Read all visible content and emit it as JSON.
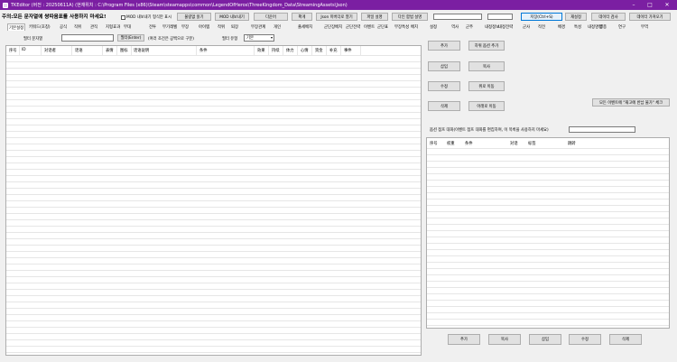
{
  "window": {
    "title": "TKEditor (버전 : 20250611A)  (현재위치 : C:\\Program Files (x86)\\Steam\\steamapps\\common\\LegendOfHeros\\ThreeKingdom_Data\\StreamingAssets\\Json)",
    "minimize": "–",
    "maximize": "□",
    "close": "✕"
  },
  "toolbar": {
    "notice": "주의:모든 문자열에 쌍따옴표를 사용하지 마세요!",
    "mod_checkbox_label": "MOD 내보내기 형식만 표시",
    "buttons": {
      "load_file": "불량없 읽기",
      "mod_export": "MOD 내보내기",
      "read": "다운어",
      "apply": "확게",
      "json_folder": "Json 미버더로 열기",
      "file_settings": "파일 설명",
      "language_settings": "다인 합법 설명",
      "save": "저장(Ctrl+S)",
      "reread": "재설정",
      "data_check": "데이터 검사",
      "data_import": "데이터 가져오기"
    }
  },
  "tabs": [
    "기본설정",
    "키워드(호칭)",
    "공식",
    "직위",
    "관직",
    "지형효과",
    "무대",
    "전투",
    "무기레벨",
    "무장",
    "아이템",
    "작위",
    "퇴장",
    "무장관계",
    "개인",
    "출세배치",
    "군단장배치",
    "군단전략",
    "이벤트",
    "군단표",
    "무장특성",
    "배치",
    "설정",
    "역사",
    "군주",
    "내정정보",
    "내정전략",
    "군사",
    "작전",
    "배경",
    "특성",
    "내정명령",
    "병종",
    "연구",
    "무역",
    "군주의 성격",
    "",
    "",
    "대원사배경",
    "중심",
    "정책"
  ],
  "left": {
    "filter_label": "필터 문자열",
    "filter_apply_button": "필터(Enter)",
    "filter_hint": "(여러 조건은 공백으로 구분)",
    "filter_type_label": "필터 유형",
    "filter_type_value": "기본",
    "columns": [
      "序号",
      "ID",
      "对话者",
      "话语",
      "表情",
      "图标",
      "话语说明",
      "",
      "",
      "",
      "",
      "",
      "",
      "",
      "条件",
      "",
      "",
      "",
      "",
      "",
      "",
      "",
      "",
      "",
      "",
      "",
      "",
      "",
      "",
      "",
      "",
      "",
      "效果",
      "持续",
      "体力",
      "心情",
      "资金",
      "补充",
      "事件"
    ]
  },
  "right": {
    "buttons": {
      "add": "추가",
      "copy_after": "하위 옵션 추가",
      "insert": "삽입",
      "copy": "복사",
      "edit": "수정",
      "move_up": "위로 이동",
      "delete": "삭제",
      "move_down": "아래로 이동"
    },
    "disable_option": "모든 이벤트에 \"재고에 반납 불가\" 체크",
    "options_label": "옵션 점프 대화(이벤트 점프 대화를 편집하며, 이 목록을 사용하지 마세요)",
    "sub_columns": [
      "序号",
      "权重",
      "条件",
      "",
      "",
      "对话",
      "标签",
      "",
      "",
      "",
      "跳转"
    ],
    "bottom_buttons": {
      "add": "추가",
      "copy": "복사",
      "insert": "삽입",
      "edit": "수정",
      "delete": "삭제"
    }
  }
}
